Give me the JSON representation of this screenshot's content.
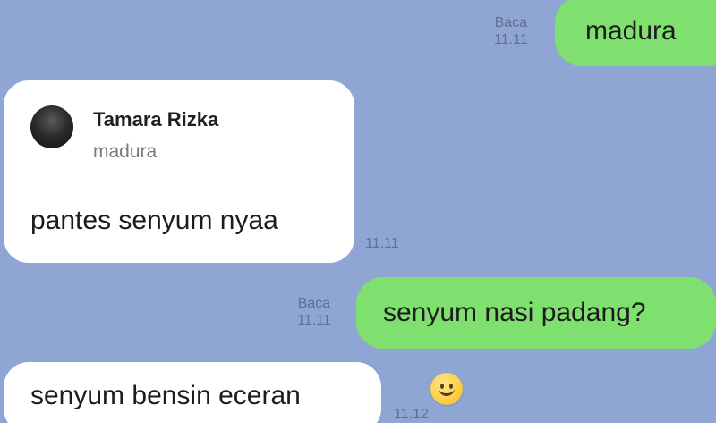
{
  "messages": [
    {
      "direction": "outgoing",
      "text": "madura",
      "read_label": "Baca",
      "time": "11.11"
    },
    {
      "direction": "incoming",
      "reply_to": {
        "name": "Tamara Rizka",
        "text": "madura"
      },
      "text": "pantes senyum nyaa",
      "time": "11.11"
    },
    {
      "direction": "outgoing",
      "text": "senyum nasi padang?",
      "read_label": "Baca",
      "time": "11.11"
    },
    {
      "direction": "incoming",
      "text": "senyum bensin eceran",
      "time": "11.12",
      "reaction": "smiley-emoji"
    }
  ],
  "colors": {
    "background": "#8fa6d4",
    "outgoing_bubble": "#7fe06f",
    "incoming_bubble": "#ffffff"
  }
}
